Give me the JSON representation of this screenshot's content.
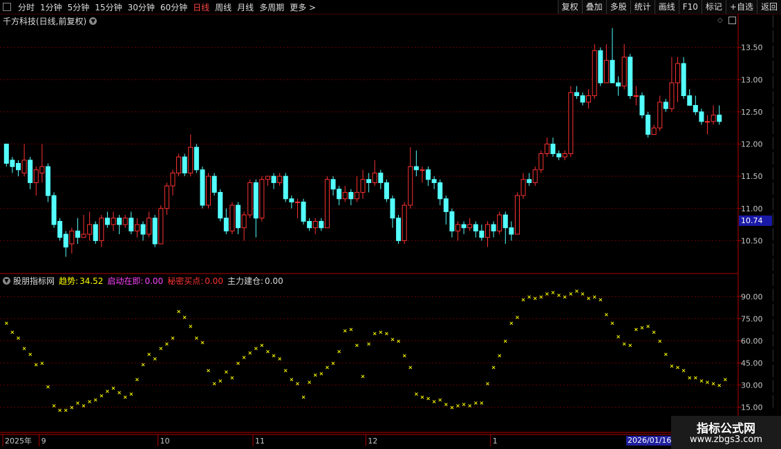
{
  "toolbar": {
    "periods": [
      "分时",
      "1分钟",
      "5分钟",
      "15分钟",
      "30分钟",
      "60分钟",
      "日线",
      "周线",
      "月线",
      "多周期",
      "更多 >"
    ],
    "active_period": "日线",
    "right_buttons": [
      "复权",
      "叠加",
      "多股",
      "统计",
      "画线",
      "F10",
      "标记",
      "+自选",
      "返回"
    ]
  },
  "stock": {
    "title": "千方科技(日线,前复权)"
  },
  "indicator": {
    "name": "股朋指标网",
    "fields": [
      {
        "label": "趋势:",
        "value": "34.52",
        "color": "#ffff00"
      },
      {
        "label": "启动在即:",
        "value": "0.00",
        "color": "#ff44ff"
      },
      {
        "label": "秘密买点:",
        "value": "0.00",
        "color": "#ff3333"
      },
      {
        "label": "主力建仓:",
        "value": "0.00",
        "color": "#dddddd"
      }
    ]
  },
  "price_axis": {
    "labels": [
      "13.50",
      "13.00",
      "12.50",
      "12.00",
      "11.50",
      "11.00",
      "10.50"
    ],
    "current": "10.74"
  },
  "ind_axis": {
    "labels": [
      "90.00",
      "75.00",
      "60.00",
      "45.00",
      "30.00",
      "15.00"
    ]
  },
  "date_axis": {
    "labels": [
      {
        "text": "2025年",
        "i": 0
      },
      {
        "text": "9",
        "i": 6
      },
      {
        "text": "10",
        "i": 26
      },
      {
        "text": "11",
        "i": 42
      },
      {
        "text": "12",
        "i": 61
      },
      {
        "text": "1",
        "i": 82
      }
    ],
    "cursor_date": "2026/01/16/五"
  },
  "watermark": {
    "line1": "指标公式网",
    "line2": "www.zbgs3.com"
  },
  "colors": {
    "up": "#ff3232",
    "down": "#54ffff",
    "dots": "#ffff00",
    "grid": "#6a0000"
  },
  "chart_data": {
    "type": "candlestick",
    "price_range": [
      10.0,
      13.85
    ],
    "indicator_range": [
      10,
      100
    ],
    "candles": [
      [
        12.0,
        11.7,
        12.0,
        11.65
      ],
      [
        11.75,
        11.65,
        11.8,
        11.55
      ],
      [
        11.7,
        11.6,
        11.75,
        11.5
      ],
      [
        11.55,
        11.75,
        12.0,
        11.5
      ],
      [
        11.75,
        11.4,
        11.8,
        11.3
      ],
      [
        11.4,
        11.6,
        11.65,
        11.2
      ],
      [
        11.55,
        11.65,
        12.0,
        11.4
      ],
      [
        11.65,
        11.2,
        11.7,
        11.1
      ],
      [
        11.2,
        10.75,
        11.25,
        10.7
      ],
      [
        10.8,
        10.55,
        10.85,
        10.5
      ],
      [
        10.6,
        10.4,
        10.65,
        10.25
      ],
      [
        10.45,
        10.65,
        10.7,
        10.3
      ],
      [
        10.65,
        10.55,
        10.85,
        10.45
      ],
      [
        10.55,
        10.6,
        10.9,
        10.55
      ],
      [
        10.6,
        10.75,
        10.95,
        10.5
      ],
      [
        10.75,
        10.5,
        10.8,
        10.45
      ],
      [
        10.5,
        10.85,
        10.9,
        10.4
      ],
      [
        10.85,
        10.75,
        10.95,
        10.7
      ],
      [
        10.75,
        10.85,
        10.95,
        10.65
      ],
      [
        10.85,
        10.75,
        10.9,
        10.6
      ],
      [
        10.75,
        10.85,
        10.9,
        10.7
      ],
      [
        10.85,
        10.65,
        10.95,
        10.6
      ],
      [
        10.65,
        10.75,
        10.85,
        10.55
      ],
      [
        10.75,
        10.6,
        10.8,
        10.5
      ],
      [
        10.6,
        10.85,
        10.95,
        10.55
      ],
      [
        10.85,
        10.45,
        10.9,
        10.4
      ],
      [
        10.45,
        11.0,
        11.05,
        10.45
      ],
      [
        11.0,
        11.35,
        11.4,
        10.9
      ],
      [
        11.35,
        11.55,
        11.6,
        11.2
      ],
      [
        11.55,
        11.8,
        11.85,
        11.5
      ],
      [
        11.8,
        11.55,
        11.85,
        11.5
      ],
      [
        11.55,
        11.95,
        12.15,
        11.5
      ],
      [
        11.95,
        11.6,
        12.0,
        11.55
      ],
      [
        11.6,
        11.05,
        11.65,
        11.0
      ],
      [
        11.05,
        11.5,
        11.55,
        11.0
      ],
      [
        11.5,
        11.25,
        11.55,
        11.2
      ],
      [
        11.25,
        10.85,
        11.3,
        10.8
      ],
      [
        10.85,
        10.65,
        11.0,
        10.6
      ],
      [
        10.65,
        11.05,
        11.1,
        10.6
      ],
      [
        11.05,
        10.7,
        11.1,
        10.6
      ],
      [
        10.7,
        10.9,
        10.95,
        10.5
      ],
      [
        10.9,
        11.4,
        11.45,
        10.85
      ],
      [
        11.4,
        10.85,
        11.45,
        10.55
      ],
      [
        10.85,
        11.45,
        11.5,
        10.8
      ],
      [
        11.45,
        11.5,
        11.5,
        11.35
      ],
      [
        11.5,
        11.4,
        11.55,
        11.3
      ],
      [
        11.4,
        11.5,
        11.55,
        11.35
      ],
      [
        11.5,
        11.15,
        11.55,
        11.1
      ],
      [
        11.15,
        11.1,
        11.2,
        11.0
      ],
      [
        11.1,
        11.1,
        11.15,
        10.85
      ],
      [
        11.1,
        10.8,
        11.15,
        10.75
      ],
      [
        10.8,
        10.7,
        10.85,
        10.65
      ],
      [
        10.7,
        10.8,
        10.85,
        10.6
      ],
      [
        10.8,
        10.7,
        10.85,
        10.65
      ],
      [
        10.7,
        11.45,
        11.5,
        10.7
      ],
      [
        11.45,
        11.3,
        11.5,
        11.2
      ],
      [
        11.3,
        11.15,
        11.35,
        11.05
      ],
      [
        11.15,
        11.25,
        11.35,
        11.1
      ],
      [
        11.25,
        11.15,
        11.3,
        11.05
      ],
      [
        11.15,
        11.25,
        11.5,
        11.1
      ],
      [
        11.25,
        11.45,
        11.6,
        11.15
      ],
      [
        11.45,
        11.4,
        11.55,
        11.25
      ],
      [
        11.4,
        11.55,
        11.75,
        11.35
      ],
      [
        11.55,
        11.4,
        11.6,
        11.3
      ],
      [
        11.4,
        11.15,
        11.45,
        11.1
      ],
      [
        11.15,
        10.85,
        11.2,
        10.7
      ],
      [
        10.85,
        10.5,
        10.9,
        10.45
      ],
      [
        10.5,
        11.05,
        11.1,
        10.45
      ],
      [
        11.05,
        11.65,
        11.95,
        11.0
      ],
      [
        11.65,
        11.6,
        11.9,
        11.5
      ],
      [
        11.6,
        11.6,
        11.65,
        11.4
      ],
      [
        11.6,
        11.45,
        11.65,
        11.35
      ],
      [
        11.45,
        11.4,
        11.5,
        11.3
      ],
      [
        11.4,
        11.15,
        11.45,
        11.05
      ],
      [
        11.15,
        10.95,
        11.2,
        10.75
      ],
      [
        10.95,
        10.65,
        11.0,
        10.55
      ],
      [
        10.65,
        10.75,
        10.8,
        10.5
      ],
      [
        10.75,
        10.7,
        10.8,
        10.6
      ],
      [
        10.7,
        10.75,
        10.85,
        10.65
      ],
      [
        10.75,
        10.65,
        10.8,
        10.55
      ],
      [
        10.65,
        10.55,
        10.75,
        10.5
      ],
      [
        10.55,
        10.75,
        10.8,
        10.4
      ],
      [
        10.75,
        10.65,
        10.8,
        10.55
      ],
      [
        10.65,
        10.9,
        10.95,
        10.6
      ],
      [
        10.9,
        10.7,
        10.95,
        10.45
      ],
      [
        10.7,
        10.6,
        10.8,
        10.5
      ],
      [
        10.6,
        11.2,
        11.25,
        10.6
      ],
      [
        11.2,
        11.45,
        11.55,
        11.15
      ],
      [
        11.45,
        11.4,
        11.55,
        11.35
      ],
      [
        11.4,
        11.6,
        11.65,
        11.35
      ],
      [
        11.6,
        11.85,
        11.9,
        11.55
      ],
      [
        11.85,
        12.0,
        12.1,
        11.8
      ],
      [
        12.0,
        11.85,
        12.1,
        11.8
      ],
      [
        11.85,
        11.8,
        11.9,
        11.75
      ],
      [
        11.8,
        11.85,
        11.9,
        11.75
      ],
      [
        11.85,
        12.8,
        12.9,
        11.8
      ],
      [
        12.8,
        12.75,
        12.9,
        12.7
      ],
      [
        12.75,
        12.65,
        12.8,
        12.6
      ],
      [
        12.65,
        12.75,
        12.85,
        12.55
      ],
      [
        12.75,
        13.45,
        13.55,
        12.7
      ],
      [
        13.45,
        12.95,
        13.5,
        12.9
      ],
      [
        12.95,
        13.3,
        13.55,
        12.95
      ],
      [
        13.3,
        12.95,
        13.8,
        12.95
      ],
      [
        12.95,
        12.9,
        13.05,
        12.75
      ],
      [
        12.9,
        13.35,
        13.55,
        12.85
      ],
      [
        13.35,
        12.75,
        13.4,
        12.7
      ],
      [
        12.75,
        12.75,
        12.9,
        12.6
      ],
      [
        12.75,
        12.45,
        12.8,
        12.4
      ],
      [
        12.45,
        12.15,
        12.5,
        12.1
      ],
      [
        12.15,
        12.25,
        12.3,
        12.15
      ],
      [
        12.25,
        12.65,
        12.75,
        12.2
      ],
      [
        12.65,
        12.55,
        12.7,
        12.5
      ],
      [
        12.55,
        12.95,
        13.35,
        12.5
      ],
      [
        12.95,
        13.25,
        13.35,
        12.65
      ],
      [
        13.25,
        12.75,
        13.35,
        12.7
      ],
      [
        12.75,
        12.6,
        12.85,
        12.6
      ],
      [
        12.6,
        12.5,
        12.75,
        12.45
      ],
      [
        12.5,
        12.35,
        12.55,
        12.3
      ],
      [
        12.35,
        12.35,
        12.45,
        12.15
      ],
      [
        12.35,
        12.45,
        12.6,
        12.3
      ],
      [
        12.45,
        12.35,
        12.6,
        12.3
      ]
    ],
    "indicator_values": [
      72,
      66,
      62,
      55,
      51,
      44,
      45,
      29,
      16,
      13,
      13,
      15,
      18,
      16,
      19,
      20,
      23,
      26,
      28,
      25,
      22,
      24,
      34,
      44,
      51,
      48,
      55,
      58,
      62,
      80,
      76,
      70,
      62,
      59,
      40,
      31,
      33,
      39,
      35,
      45,
      49,
      52,
      55,
      57,
      53,
      50,
      48,
      40,
      34,
      31,
      22,
      32,
      37,
      38,
      42,
      45,
      53,
      67,
      68,
      57,
      36,
      58,
      65,
      66,
      65,
      61,
      60,
      50,
      42,
      24,
      22,
      21,
      19,
      20,
      17,
      15,
      16,
      17,
      16,
      18,
      18,
      31,
      42,
      50,
      60,
      72,
      76,
      88,
      90,
      89,
      90,
      92,
      93,
      91,
      90,
      92,
      94,
      92,
      89,
      90,
      88,
      78,
      72,
      63,
      58,
      57,
      68,
      69,
      70,
      66,
      60,
      51,
      43,
      42,
      40,
      35,
      35,
      33,
      32,
      31,
      30,
      34
    ]
  }
}
